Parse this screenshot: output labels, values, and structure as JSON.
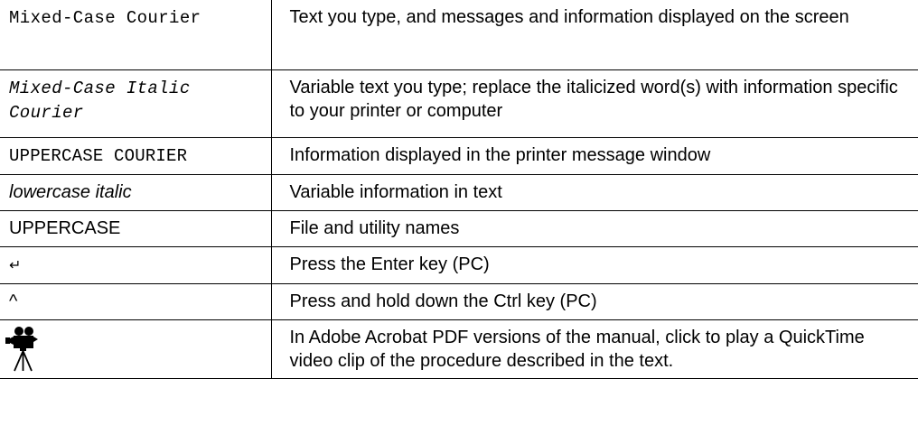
{
  "rows": [
    {
      "convention": "Mixed-Case Courier",
      "description": "Text you type, and messages and information displayed on the screen"
    },
    {
      "convention": "Mixed-Case Italic Courier",
      "description": "Variable text you type; replace the italicized word(s) with information specific to your printer or computer"
    },
    {
      "convention": "UPPERCASE COURIER",
      "description": "Information displayed in the printer message window"
    },
    {
      "convention": "lowercase italic",
      "description": "Variable information in text"
    },
    {
      "convention": "UPPERCASE",
      "description": "File and utility names"
    },
    {
      "convention": "↵",
      "description": "Press the Enter key (PC)"
    },
    {
      "convention": "^",
      "description": "Press and hold down the Ctrl key (PC)"
    },
    {
      "convention_icon": "movie-camera-icon",
      "description": "In Adobe Acrobat PDF versions of the manual, click to play a QuickTime video clip of the procedure described in the text."
    }
  ]
}
